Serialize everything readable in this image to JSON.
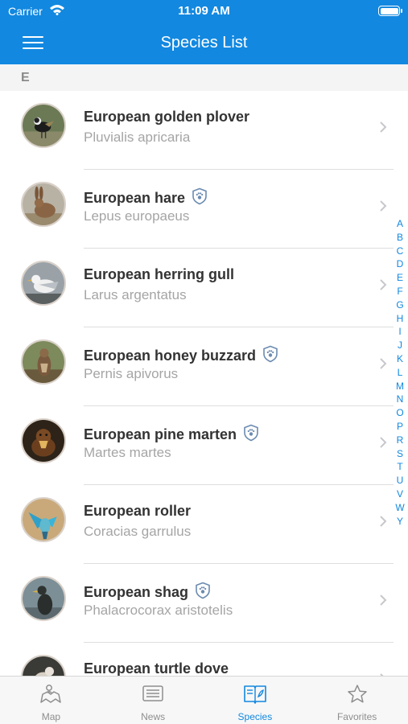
{
  "status_bar": {
    "carrier": "Carrier",
    "time": "11:09 AM"
  },
  "header": {
    "title": "Species List"
  },
  "section": {
    "letter": "E"
  },
  "species": [
    {
      "common": "European golden plover",
      "latin": "Pluvialis apricaria",
      "protected": false
    },
    {
      "common": "European hare",
      "latin": "Lepus europaeus",
      "protected": true
    },
    {
      "common": "European herring gull",
      "latin": "Larus argentatus",
      "protected": false
    },
    {
      "common": "European honey buzzard",
      "latin": "Pernis apivorus",
      "protected": true
    },
    {
      "common": "European pine marten",
      "latin": "Martes martes",
      "protected": true
    },
    {
      "common": "European roller",
      "latin": "Coracias garrulus",
      "protected": false
    },
    {
      "common": "European shag",
      "latin": "Phalacrocorax aristotelis",
      "protected": true
    },
    {
      "common": "European turtle dove",
      "latin": "",
      "protected": false
    }
  ],
  "index_letters": [
    "A",
    "B",
    "C",
    "D",
    "E",
    "F",
    "G",
    "H",
    "I",
    "J",
    "K",
    "L",
    "M",
    "N",
    "O",
    "P",
    "R",
    "S",
    "T",
    "U",
    "V",
    "W",
    "Y"
  ],
  "tabs": [
    {
      "label": "Map",
      "icon": "map-icon"
    },
    {
      "label": "News",
      "icon": "news-icon"
    },
    {
      "label": "Species",
      "icon": "species-book-icon"
    },
    {
      "label": "Favorites",
      "icon": "star-icon"
    }
  ],
  "active_tab": "Species",
  "colors": {
    "accent": "#1288e0",
    "secondary_text": "#a5a5a5",
    "badge": "#6b8bb0"
  }
}
